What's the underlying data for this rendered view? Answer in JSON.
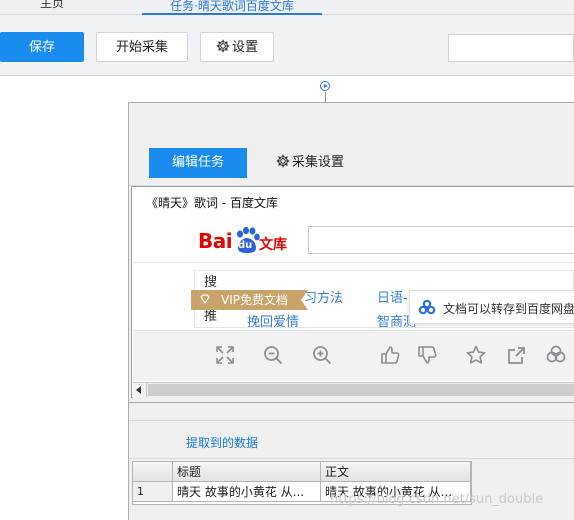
{
  "top_tabs": {
    "left_label": "主页",
    "active_label": "任务·晴天歌词百度文库"
  },
  "toolbar": {
    "save_label": "保存",
    "start_label": "开始采集",
    "settings_label": "设置"
  },
  "panel": {
    "edit_tab_label": "编辑任务",
    "collect_settings_label": "采集设置"
  },
  "browser": {
    "page_title": "《晴天》歌词 - 百度文库",
    "logo_text": "Bai",
    "logo_du": "du",
    "logo_wenku": "文库",
    "related_label": "搜索推",
    "related_links": [
      "习方法",
      "日语-",
      "挽回爱情",
      "智商测"
    ],
    "vip_badge": "VIP免费文档",
    "tooltip_text": "文档可以转存到百度网盘",
    "toolbar_icons": [
      "fullscreen-icon",
      "zoom-out-icon",
      "zoom-in-icon",
      "thumbs-up-icon",
      "thumbs-down-icon",
      "star-icon",
      "share-icon",
      "more-icon"
    ]
  },
  "extracted": {
    "tab_label": "提取到的数据",
    "columns": [
      "标题",
      "正文"
    ],
    "rows": [
      {
        "num": "1",
        "title": "晴天 故事的小黄花 从...",
        "body": "晴天 故事的小黄花 从..."
      }
    ]
  },
  "watermark": "https://blog.csdn.net/sun_double",
  "colors": {
    "accent": "#1a8cf0",
    "baidu_red": "#e10602",
    "vip_gold": "#c8a46b",
    "link_blue": "#3a7bd5"
  }
}
